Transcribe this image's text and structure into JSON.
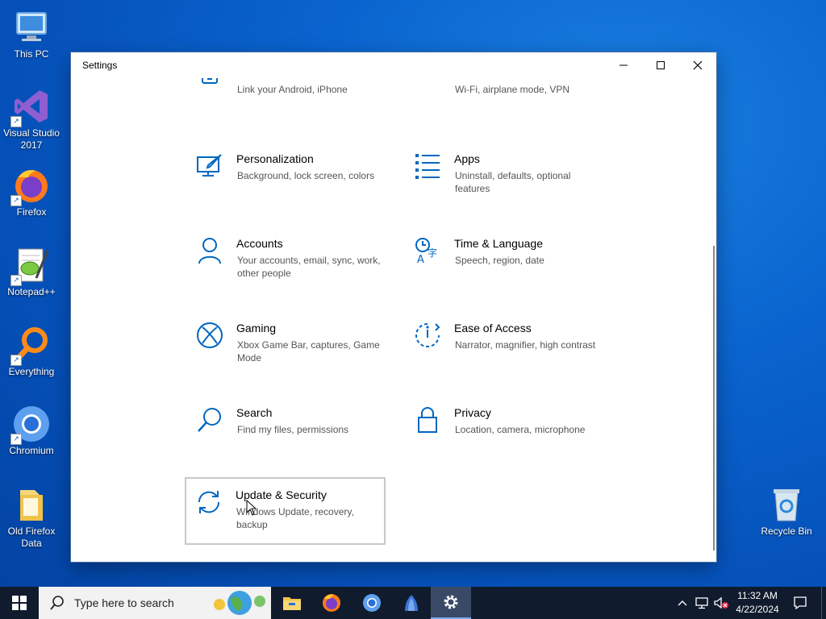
{
  "desktop": {
    "icons": [
      {
        "label": "This PC",
        "icon": "this-pc-icon"
      },
      {
        "label": "Visual Studio 2017",
        "icon": "visual-studio-icon"
      },
      {
        "label": "Firefox",
        "icon": "firefox-icon"
      },
      {
        "label": "Notepad++",
        "icon": "notepad-plus-plus-icon"
      },
      {
        "label": "Everything",
        "icon": "everything-search-icon"
      },
      {
        "label": "Chromium",
        "icon": "chromium-icon"
      },
      {
        "label": "Old Firefox Data",
        "icon": "folder-icon"
      },
      {
        "label": "Recycle Bin",
        "icon": "recycle-bin-icon"
      }
    ]
  },
  "window": {
    "title": "Settings",
    "controls": {
      "minimize": "minimize-icon",
      "maximize": "maximize-icon",
      "close": "close-icon"
    }
  },
  "categories": [
    {
      "name": "",
      "desc": "Link your Android, iPhone",
      "icon": "phone-icon"
    },
    {
      "name": "",
      "desc": "Wi-Fi, airplane mode, VPN",
      "icon": "globe-network-icon"
    },
    {
      "name": "Personalization",
      "desc": "Background, lock screen, colors",
      "icon": "personalization-icon"
    },
    {
      "name": "Apps",
      "desc": "Uninstall, defaults, optional features",
      "icon": "apps-list-icon"
    },
    {
      "name": "Accounts",
      "desc": "Your accounts, email, sync, work, other people",
      "icon": "person-icon"
    },
    {
      "name": "Time & Language",
      "desc": "Speech, region, date",
      "icon": "time-language-icon"
    },
    {
      "name": "Gaming",
      "desc": "Xbox Game Bar, captures, Game Mode",
      "icon": "xbox-icon"
    },
    {
      "name": "Ease of Access",
      "desc": "Narrator, magnifier, high contrast",
      "icon": "ease-of-access-icon"
    },
    {
      "name": "Search",
      "desc": "Find my files, permissions",
      "icon": "search-icon"
    },
    {
      "name": "Privacy",
      "desc": "Location, camera, microphone",
      "icon": "lock-icon"
    },
    {
      "name": "Update & Security",
      "desc": "Windows Update, recovery, backup",
      "icon": "sync-arrows-icon"
    }
  ],
  "taskbar": {
    "search_placeholder": "Type here to search",
    "pinned": [
      "start-icon",
      "file-explorer-icon",
      "firefox-icon",
      "chromium-icon",
      "app-icon",
      "settings-gear-icon"
    ],
    "time": "11:32 AM",
    "date": "4/22/2024"
  },
  "colors": {
    "accent": "#0067c0",
    "taskbar": "#101b2d",
    "desktop": "#0a64cf"
  }
}
